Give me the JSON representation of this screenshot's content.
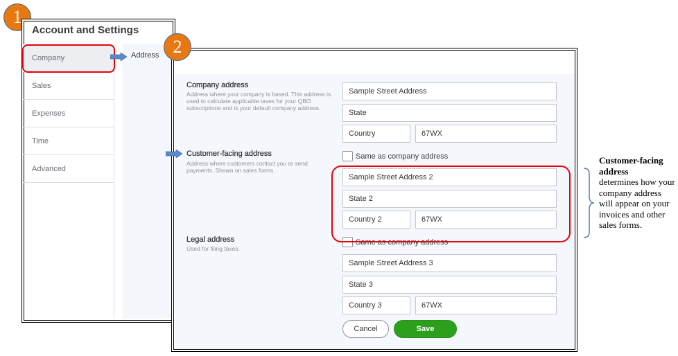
{
  "steps": [
    "1",
    "2"
  ],
  "settings": {
    "title": "Account and Settings",
    "sidebar": [
      {
        "label": "Company",
        "active": true
      },
      {
        "label": "Sales"
      },
      {
        "label": "Expenses"
      },
      {
        "label": "Time"
      },
      {
        "label": "Advanced"
      }
    ],
    "subnav": "Address"
  },
  "form": {
    "company": {
      "label": "Company address",
      "desc": "Address where your company is based. This address is used to calculate applicable taxes for your QBO subscriptions and is your default company address.",
      "street": "Sample Street Address",
      "state": "State",
      "country": "Country",
      "zip": "67WX"
    },
    "customer": {
      "label": "Customer-facing address",
      "desc": "Address where customers contact you or send payments. Shown on sales forms.",
      "same_label": "Same as company address",
      "same_checked": false,
      "street": "Sample Street Address 2",
      "state": "State 2",
      "country": "Country 2",
      "zip": "67WX"
    },
    "legal": {
      "label": "Legal address",
      "desc": "Used for filing taxes.",
      "same_label": "Same as company address",
      "same_checked": false,
      "street": "Sample Street Address 3",
      "state": "State 3",
      "country": "Country 3",
      "zip": "67WX"
    },
    "cancel": "Cancel",
    "save": "Save"
  },
  "annotation": {
    "bold": "Customer-facing address",
    "text": "determines how your company address will appear on your invoices and other sales forms."
  },
  "colors": {
    "accent_orange": "#e87811",
    "highlight_red": "#e8000b",
    "save_green": "#2ca01c",
    "arrow_blue": "#5b8ac6"
  }
}
